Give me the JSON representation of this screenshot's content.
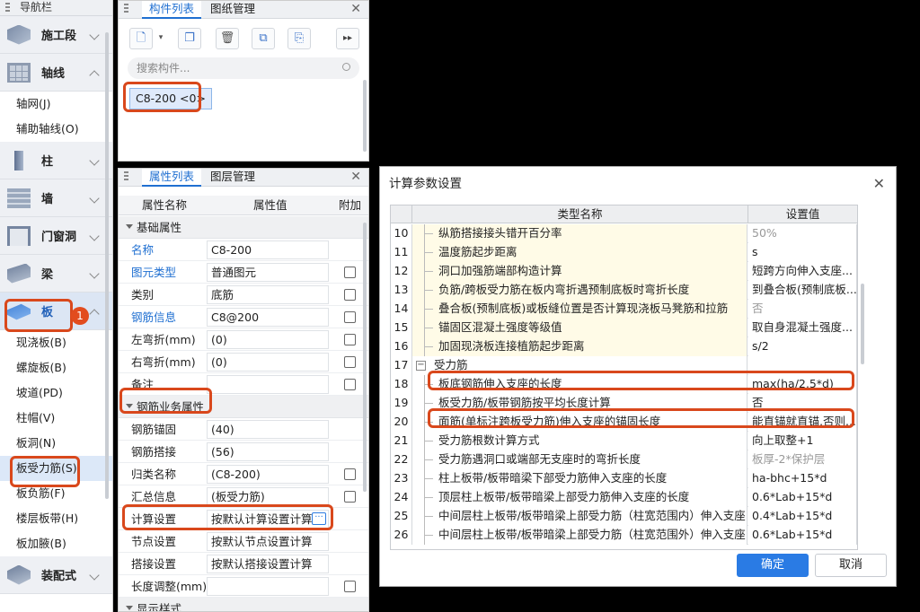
{
  "nav": {
    "title": "导航栏",
    "categories": [
      {
        "label": "施工段",
        "icon": "construction-stage-icon"
      },
      {
        "label": "轴线",
        "icon": "axis-grid-icon"
      },
      {
        "label": "柱",
        "icon": "column-icon"
      },
      {
        "label": "墙",
        "icon": "wall-icon"
      },
      {
        "label": "门窗洞",
        "icon": "door-window-icon"
      },
      {
        "label": "梁",
        "icon": "beam-icon"
      },
      {
        "label": "板",
        "icon": "slab-icon"
      },
      {
        "label": "装配式",
        "icon": "prefab-icon"
      }
    ],
    "axis_items": [
      "轴网(J)",
      "辅助轴线(O)"
    ],
    "slab_items": [
      "现浇板(B)",
      "螺旋板(B)",
      "坡道(PD)",
      "柱帽(V)",
      "板洞(N)",
      "板受力筋(S)",
      "板负筋(F)",
      "楼层板带(H)",
      "板加腋(B)"
    ],
    "badge": "1"
  },
  "comp": {
    "tabs": [
      "构件列表",
      "图纸管理"
    ],
    "search_placeholder": "搜索构件...",
    "item": "C8-200 <0>"
  },
  "prop": {
    "tabs": [
      "属性列表",
      "图层管理"
    ],
    "headers": [
      "属性名称",
      "属性值",
      "附加"
    ],
    "section1": "基础属性",
    "basic": [
      {
        "name": "名称",
        "value": "C8-200"
      },
      {
        "name": "图元类型",
        "value": "普通图元"
      },
      {
        "name": "类别",
        "value": "底筋"
      },
      {
        "name": "钢筋信息",
        "value": "C8@200"
      },
      {
        "name": "左弯折(mm)",
        "value": "(0)"
      },
      {
        "name": "右弯折(mm)",
        "value": "(0)"
      },
      {
        "name": "备注",
        "value": ""
      }
    ],
    "section2": "钢筋业务属性",
    "rebar": [
      {
        "name": "钢筋锚固",
        "value": "(40)"
      },
      {
        "name": "钢筋搭接",
        "value": "(56)"
      },
      {
        "name": "归类名称",
        "value": "(C8-200)"
      },
      {
        "name": "汇总信息",
        "value": "(板受力筋)"
      },
      {
        "name": "计算设置",
        "value": "按默认计算设置计算"
      },
      {
        "name": "节点设置",
        "value": "按默认节点设置计算"
      },
      {
        "name": "搭接设置",
        "value": "按默认搭接设置计算"
      },
      {
        "name": "长度调整(mm)",
        "value": ""
      }
    ],
    "section3": "显示样式",
    "dots": "···"
  },
  "dialog": {
    "title": "计算参数设置",
    "col_name": "类型名称",
    "col_value": "设置值",
    "rows": [
      {
        "n": "10",
        "name": "纵筋搭接接头错开百分率",
        "value": "50%",
        "gray": true
      },
      {
        "n": "11",
        "name": "温度筋起步距离",
        "value": "s"
      },
      {
        "n": "12",
        "name": "洞口加强筋端部构造计算",
        "value": "短跨方向伸入支座..."
      },
      {
        "n": "13",
        "name": "负筋/跨板受力筋在板内弯折遇预制底板时弯折长度",
        "value": "到叠合板(预制底板..."
      },
      {
        "n": "14",
        "name": "叠合板(预制底板)或板缝位置是否计算现浇板马凳筋和拉筋",
        "value": "否",
        "gray": true
      },
      {
        "n": "15",
        "name": "锚固区混凝土强度等级值",
        "value": "取自身混凝土强度..."
      },
      {
        "n": "16",
        "name": "加固现浇板连接植筋起步距离",
        "value": "s/2"
      },
      {
        "n": "17",
        "name": "受力筋",
        "value": "",
        "group": true
      },
      {
        "n": "18",
        "name": "板底钢筋伸入支座的长度",
        "value": "max(ha/2,5*d)"
      },
      {
        "n": "19",
        "name": "板受力筋/板带钢筋按平均长度计算",
        "value": "否"
      },
      {
        "n": "20",
        "name": "面筋(单标注跨板受力筋)伸入支座的锚固长度",
        "value": "能直锚就直锚,否则..."
      },
      {
        "n": "21",
        "name": "受力筋根数计算方式",
        "value": "向上取整+1"
      },
      {
        "n": "22",
        "name": "受力筋遇洞口或端部无支座时的弯折长度",
        "value": "板厚-2*保护层",
        "gray": true
      },
      {
        "n": "23",
        "name": "柱上板带/板带暗梁下部受力筋伸入支座的长度",
        "value": "ha-bhc+15*d"
      },
      {
        "n": "24",
        "name": "顶层柱上板带/板带暗梁上部受力筋伸入支座的长度",
        "value": "0.6*Lab+15*d"
      },
      {
        "n": "25",
        "name": "中间层柱上板带/板带暗梁上部受力筋（柱宽范围内）伸入支座...",
        "value": "0.4*Lab+15*d"
      },
      {
        "n": "26",
        "name": "中间层柱上板带/板带暗梁上部受力筋（柱宽范围外）伸入支座...",
        "value": "0.6*Lab+15*d"
      }
    ],
    "ok": "确定",
    "cancel": "取消"
  }
}
